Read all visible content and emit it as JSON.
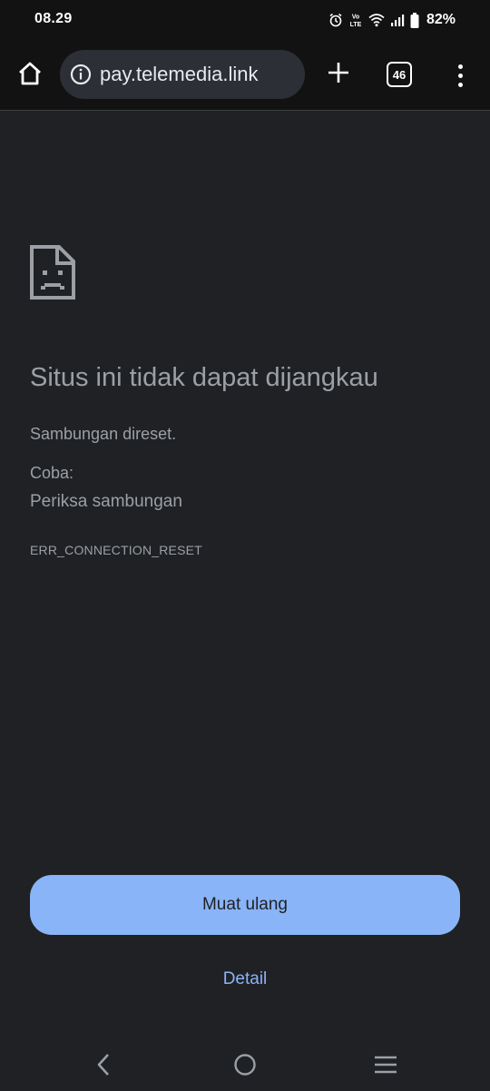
{
  "status_bar": {
    "time": "08.29",
    "battery": "82%",
    "icons": [
      "alarm-icon",
      "volte-icon",
      "wifi-icon",
      "signal-icon",
      "battery-icon"
    ]
  },
  "toolbar": {
    "url": "pay.telemedia.link",
    "tab_count": "46",
    "icons": [
      "home-icon",
      "info-icon",
      "plus-icon",
      "tab-switcher-icon",
      "more-vert-icon"
    ]
  },
  "error": {
    "icon": "sad-page-icon",
    "title": "Situs ini tidak dapat dijangkau",
    "description": "Sambungan direset.",
    "try_label": "Coba:",
    "suggestions": [
      "Periksa sambungan"
    ],
    "code": "ERR_CONNECTION_RESET"
  },
  "actions": {
    "reload_label": "Muat ulang",
    "details_label": "Detail"
  },
  "colors": {
    "background": "#202124",
    "toolbar": "#121212",
    "accent": "#8ab4f8",
    "text_secondary": "#9aa0a6"
  },
  "nav_bar": {
    "icons": [
      "back-icon",
      "home-circle-icon",
      "recents-icon"
    ]
  }
}
